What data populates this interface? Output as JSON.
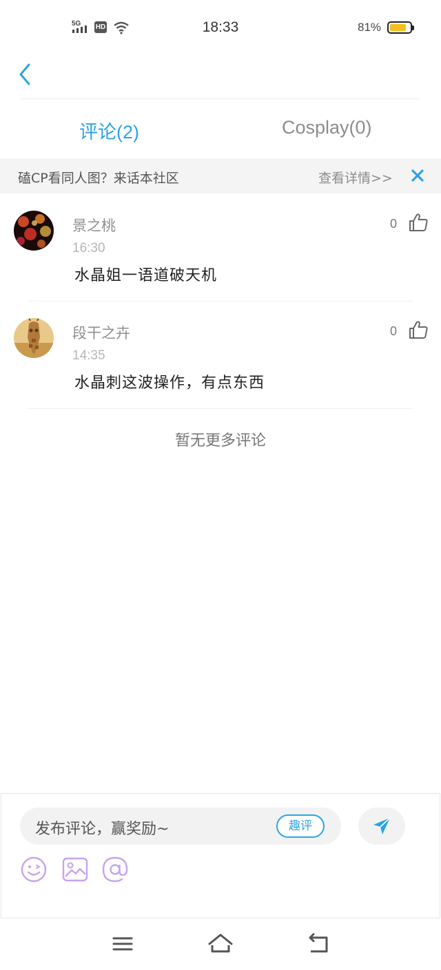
{
  "status_bar": {
    "time": "18:33",
    "battery_percent": "81%",
    "battery_level": 0.81,
    "network": "5G",
    "hd": "HD"
  },
  "nav": {
    "back_icon": "chevron-left-icon"
  },
  "tabs": [
    {
      "label": "评论(2)",
      "active": true
    },
    {
      "label": "Cosplay(0)",
      "active": false
    }
  ],
  "banner": {
    "text": "磕CP看同人图？来话本社区",
    "link": "查看详情>>",
    "close_icon": "close-icon"
  },
  "comments": [
    {
      "name": "景之桃",
      "time": "16:30",
      "text": "水晶姐一语道破天机",
      "likes": "0"
    },
    {
      "name": "段干之卉",
      "time": "14:35",
      "text": "水晶刺这波操作，有点东西",
      "likes": "0"
    }
  ],
  "no_more": "暂无更多评论",
  "composer": {
    "placeholder": "发布评论，赢奖励~",
    "badge": "趣评",
    "tools": [
      "emoji-icon",
      "image-icon",
      "at-icon"
    ],
    "send_icon": "send-icon"
  },
  "colors": {
    "accent": "#2aa3e3",
    "tool_icon": "#c5a3ef",
    "battery": "#f5bf1d"
  }
}
